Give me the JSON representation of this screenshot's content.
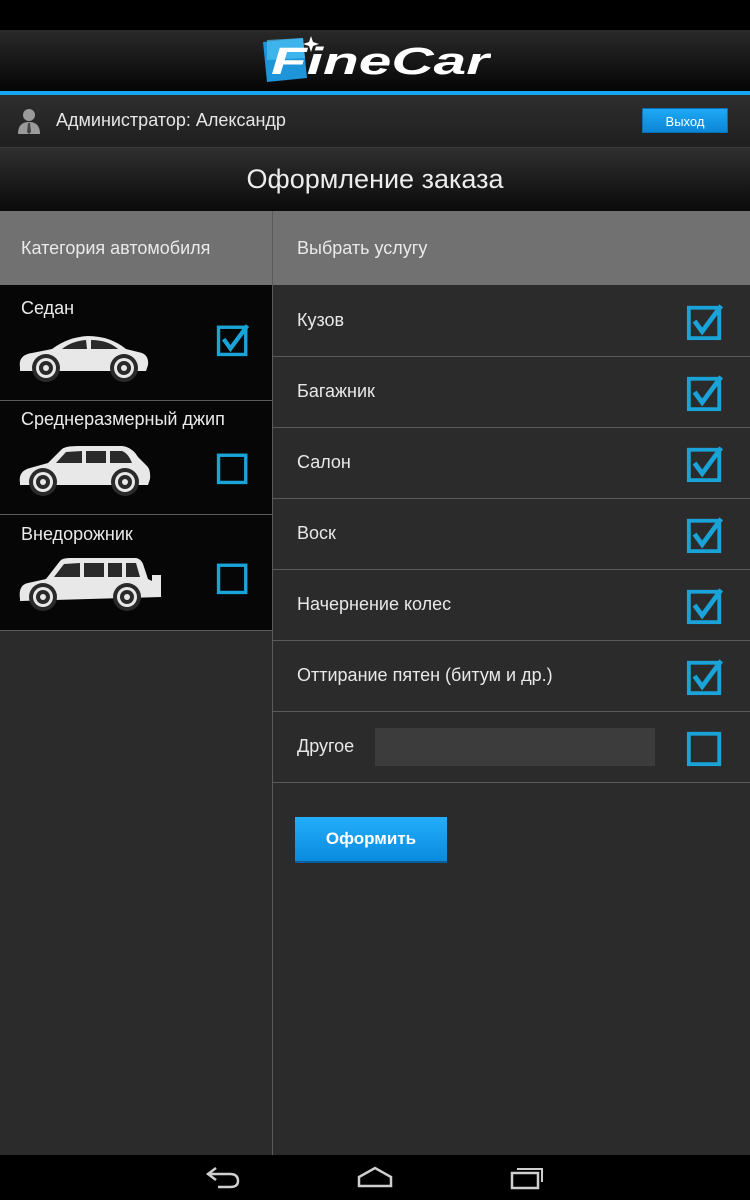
{
  "app": {
    "logo_text": "FineCar",
    "colors": {
      "accent": "#17a4f0",
      "checkbox": "#1aa3d8"
    }
  },
  "header": {
    "user_label": "Администратор: Александр",
    "logout_label": "Выход"
  },
  "page": {
    "title": "Оформление заказа"
  },
  "categories": {
    "header": "Категория автомобиля",
    "items": [
      {
        "label": "Седан",
        "checked": true,
        "icon": "sedan-icon"
      },
      {
        "label": "Среднеразмерный джип",
        "checked": false,
        "icon": "midsize-suv-icon"
      },
      {
        "label": "Внедорожник",
        "checked": false,
        "icon": "offroad-suv-icon"
      }
    ]
  },
  "services": {
    "header": "Выбрать услугу",
    "items": [
      {
        "label": "Кузов",
        "checked": true
      },
      {
        "label": "Багажник",
        "checked": true
      },
      {
        "label": "Салон",
        "checked": true
      },
      {
        "label": "Воск",
        "checked": true
      },
      {
        "label": "Начернение колес",
        "checked": true
      },
      {
        "label": "Оттирание пятен (битум и др.)",
        "checked": true
      },
      {
        "label": "Другое",
        "checked": false,
        "input_value": ""
      }
    ]
  },
  "submit_label": "Оформить",
  "navbar": {
    "icons": [
      "back-icon",
      "home-icon",
      "recent-apps-icon"
    ]
  }
}
